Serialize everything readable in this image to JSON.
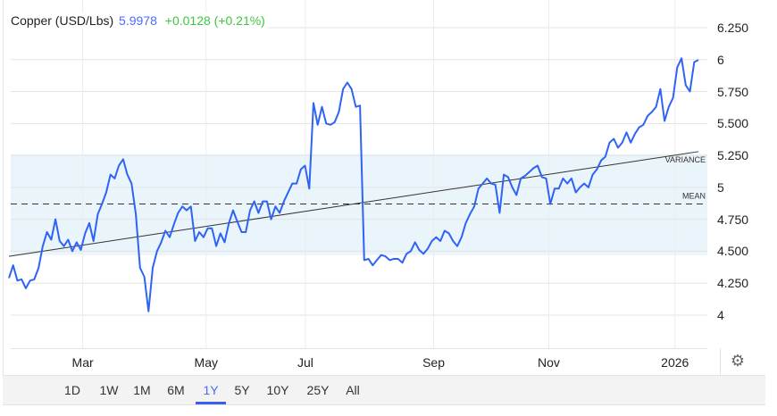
{
  "header": {
    "name": "Copper (USD/Lbs)",
    "price": "5.9978",
    "change": "+0.0128 (+0.21%)"
  },
  "colors": {
    "line": "#2f63f5",
    "band": "#eaf4fb",
    "price": "#4a6cf7",
    "change": "#3ec63e"
  },
  "chart_data": {
    "type": "line",
    "title": "Copper (USD/Lbs)",
    "ylim": [
      3.72,
      6.39
    ],
    "y_ticks": [
      "6.250",
      "6",
      "5.750",
      "5.500",
      "5.250",
      "5",
      "4.750",
      "4.500",
      "4.250",
      "4"
    ],
    "y_tick_values": [
      6.25,
      6,
      5.75,
      5.5,
      5.25,
      5,
      4.75,
      4.5,
      4.25,
      4
    ],
    "x_ticks": [
      "Mar",
      "May",
      "Jul",
      "Sep",
      "Nov",
      "2026"
    ],
    "x_tick_positions": [
      0.107,
      0.286,
      0.43,
      0.616,
      0.783,
      0.966
    ],
    "grid": true,
    "series": [
      {
        "name": "Copper",
        "values": [
          4.29,
          4.39,
          4.27,
          4.28,
          4.21,
          4.27,
          4.28,
          4.37,
          4.54,
          4.65,
          4.59,
          4.75,
          4.58,
          4.54,
          4.59,
          4.5,
          4.57,
          4.51,
          4.64,
          4.72,
          4.58,
          4.79,
          4.87,
          4.96,
          5.1,
          5.07,
          5.17,
          5.22,
          5.1,
          5.03,
          4.79,
          4.37,
          4.3,
          4.03,
          4.37,
          4.5,
          4.57,
          4.66,
          4.61,
          4.71,
          4.8,
          4.85,
          4.82,
          4.85,
          4.58,
          4.65,
          4.61,
          4.68,
          4.68,
          4.54,
          4.64,
          4.57,
          4.72,
          4.82,
          4.73,
          4.65,
          4.65,
          4.82,
          4.89,
          4.8,
          4.89,
          4.89,
          4.75,
          4.85,
          4.8,
          4.89,
          4.96,
          5.03,
          5.03,
          5.14,
          5.17,
          4.99,
          5.66,
          5.49,
          5.63,
          5.5,
          5.49,
          5.51,
          5.59,
          5.77,
          5.82,
          5.77,
          5.63,
          5.64,
          4.43,
          4.44,
          4.39,
          4.43,
          4.47,
          4.46,
          4.43,
          4.44,
          4.44,
          4.41,
          4.48,
          4.5,
          4.57,
          4.51,
          4.48,
          4.52,
          4.58,
          4.61,
          4.58,
          4.66,
          4.64,
          4.58,
          4.54,
          4.61,
          4.72,
          4.79,
          4.85,
          4.99,
          5.03,
          5.07,
          5.03,
          5.02,
          4.8,
          5.1,
          5.08,
          5.0,
          4.94,
          5.07,
          5.09,
          5.12,
          5.15,
          5.17,
          5.08,
          5.07,
          4.87,
          4.99,
          4.99,
          5.07,
          5.03,
          5.07,
          4.96,
          5.0,
          5.03,
          5.0,
          5.1,
          5.14,
          5.21,
          5.24,
          5.35,
          5.38,
          5.31,
          5.35,
          5.43,
          5.35,
          5.42,
          5.47,
          5.49,
          5.56,
          5.59,
          5.63,
          5.77,
          5.52,
          5.63,
          5.7,
          5.94,
          6.01,
          5.8,
          5.75,
          5.98,
          5.9978
        ]
      }
    ],
    "mean": {
      "label": "MEAN",
      "value": 4.87
    },
    "variance": {
      "label": "VARIANCE",
      "upper": 5.26,
      "lower": 4.47
    },
    "trendline": {
      "start": 4.46,
      "end": 5.28
    }
  },
  "range_buttons": [
    "1D",
    "1W",
    "1M",
    "6M",
    "1Y",
    "5Y",
    "10Y",
    "25Y",
    "All"
  ],
  "active_range": "1Y",
  "settings_icon": "gear-icon"
}
